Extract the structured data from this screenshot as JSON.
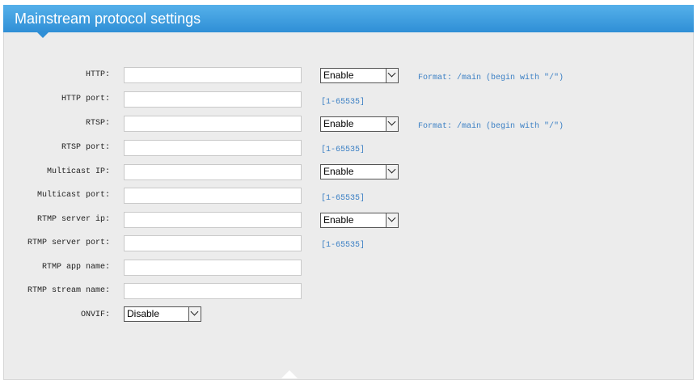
{
  "header": {
    "title": "Mainstream protocol settings"
  },
  "fields": [
    {
      "label": "HTTP:",
      "value": "",
      "select": "Enable",
      "hint": "Format: /main (begin with \"/\")"
    },
    {
      "label": "HTTP port:",
      "value": "",
      "hint": "[1-65535]"
    },
    {
      "label": "RTSP:",
      "value": "",
      "select": "Enable",
      "hint": "Format: /main (begin with \"/\")"
    },
    {
      "label": "RTSP port:",
      "value": "",
      "hint": "[1-65535]"
    },
    {
      "label": "Multicast IP:",
      "value": "",
      "select": "Enable"
    },
    {
      "label": "Multicast port:",
      "value": "",
      "hint": "[1-65535]"
    },
    {
      "label": "RTMP server ip:",
      "value": "",
      "select": "Enable"
    },
    {
      "label": "RTMP server port:",
      "value": "",
      "hint": "[1-65535]"
    },
    {
      "label": "RTMP app name:",
      "value": ""
    },
    {
      "label": "RTMP stream name:",
      "value": ""
    },
    {
      "label": "ONVIF:",
      "select": "Disable"
    }
  ]
}
